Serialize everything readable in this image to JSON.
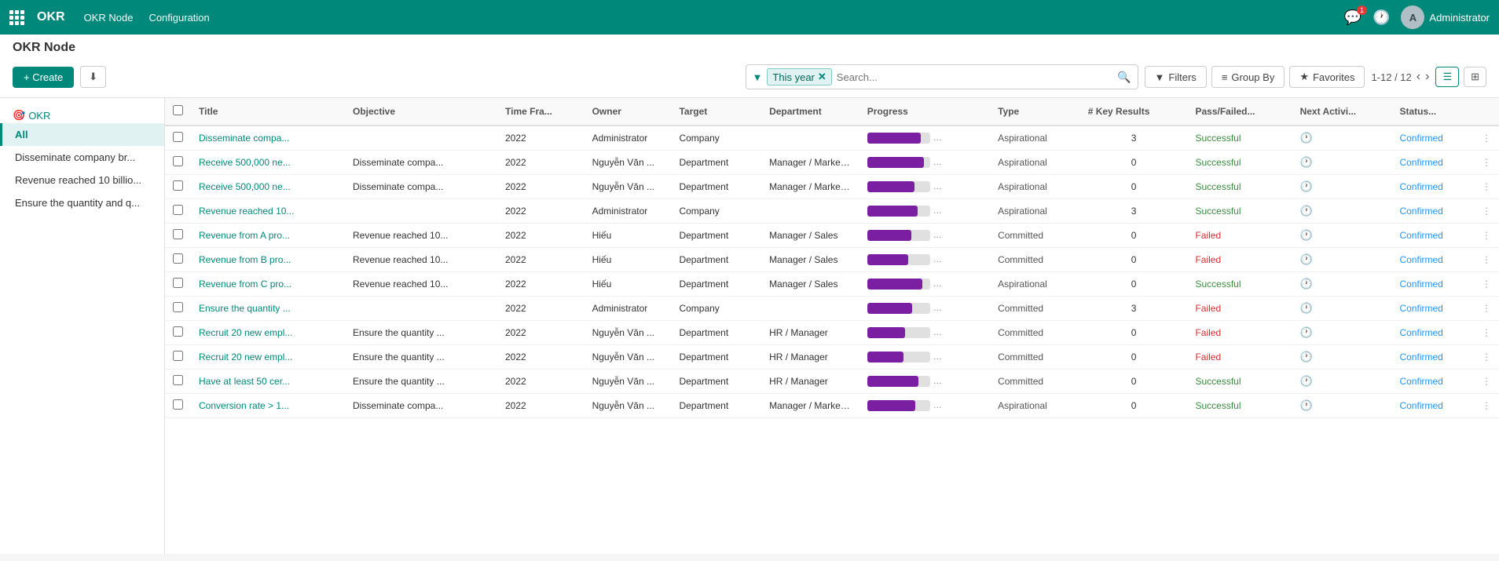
{
  "topnav": {
    "app_icon": "grid-icon",
    "app_name": "OKR",
    "menu": [
      "OKR Node",
      "Configuration"
    ],
    "chat_badge": "1",
    "user_name": "Administrator"
  },
  "page": {
    "title": "OKR Node",
    "create_label": "+ Create",
    "download_label": "⬇"
  },
  "search": {
    "filter_tag": "This year",
    "placeholder": "Search..."
  },
  "toolbar": {
    "filters_label": "Filters",
    "group_by_label": "Group By",
    "favorites_label": "Favorites",
    "pagination": "1-12 / 12"
  },
  "sidebar": {
    "section_label": "OKR",
    "items": [
      {
        "label": "All",
        "active": true
      },
      {
        "label": "Disseminate company br...",
        "active": false
      },
      {
        "label": "Revenue reached 10 billio...",
        "active": false
      },
      {
        "label": "Ensure the quantity and q...",
        "active": false
      }
    ]
  },
  "table": {
    "headers": [
      "Title",
      "Objective",
      "Time Fra...",
      "Owner",
      "Target",
      "Department",
      "Progress",
      "Type",
      "# Key Results",
      "Pass/Failed...",
      "Next Activi...",
      "Status..."
    ],
    "rows": [
      {
        "title": "Disseminate compa...",
        "objective": "",
        "time_frame": "2022",
        "owner": "Administrator",
        "target": "Company",
        "department": "",
        "progress": 85,
        "type": "Aspirational",
        "key_results": "3",
        "pass_failed": "Successful",
        "status": "Confirmed"
      },
      {
        "title": "Receive 500,000 ne...",
        "objective": "Disseminate compa...",
        "time_frame": "2022",
        "owner": "Nguyễn Văn ...",
        "target": "Department",
        "department": "Manager / Marketing",
        "progress": 90,
        "type": "Aspirational",
        "key_results": "0",
        "pass_failed": "Successful",
        "status": "Confirmed"
      },
      {
        "title": "Receive 500,000 ne...",
        "objective": "Disseminate compa...",
        "time_frame": "2022",
        "owner": "Nguyễn Văn ...",
        "target": "Department",
        "department": "Manager / Marketing",
        "progress": 75,
        "type": "Aspirational",
        "key_results": "0",
        "pass_failed": "Successful",
        "status": "Confirmed"
      },
      {
        "title": "Revenue reached 10...",
        "objective": "",
        "time_frame": "2022",
        "owner": "Administrator",
        "target": "Company",
        "department": "",
        "progress": 80,
        "type": "Aspirational",
        "key_results": "3",
        "pass_failed": "Successful",
        "status": "Confirmed"
      },
      {
        "title": "Revenue from A pro...",
        "objective": "Revenue reached 10...",
        "time_frame": "2022",
        "owner": "Hiếu",
        "target": "Department",
        "department": "Manager / Sales",
        "progress": 70,
        "type": "Committed",
        "key_results": "0",
        "pass_failed": "Failed",
        "status": "Confirmed"
      },
      {
        "title": "Revenue from B pro...",
        "objective": "Revenue reached 10...",
        "time_frame": "2022",
        "owner": "Hiếu",
        "target": "Department",
        "department": "Manager / Sales",
        "progress": 65,
        "type": "Committed",
        "key_results": "0",
        "pass_failed": "Failed",
        "status": "Confirmed"
      },
      {
        "title": "Revenue from C pro...",
        "objective": "Revenue reached 10...",
        "time_frame": "2022",
        "owner": "Hiếu",
        "target": "Department",
        "department": "Manager / Sales",
        "progress": 88,
        "type": "Aspirational",
        "key_results": "0",
        "pass_failed": "Successful",
        "status": "Confirmed"
      },
      {
        "title": "Ensure the quantity ...",
        "objective": "",
        "time_frame": "2022",
        "owner": "Administrator",
        "target": "Company",
        "department": "",
        "progress": 72,
        "type": "Committed",
        "key_results": "3",
        "pass_failed": "Failed",
        "status": "Confirmed"
      },
      {
        "title": "Recruit 20 new empl...",
        "objective": "Ensure the quantity ...",
        "time_frame": "2022",
        "owner": "Nguyễn Văn ...",
        "target": "Department",
        "department": "HR / Manager",
        "progress": 60,
        "type": "Committed",
        "key_results": "0",
        "pass_failed": "Failed",
        "status": "Confirmed"
      },
      {
        "title": "Recruit 20 new empl...",
        "objective": "Ensure the quantity ...",
        "time_frame": "2022",
        "owner": "Nguyễn Văn ...",
        "target": "Department",
        "department": "HR / Manager",
        "progress": 58,
        "type": "Committed",
        "key_results": "0",
        "pass_failed": "Failed",
        "status": "Confirmed"
      },
      {
        "title": "Have at least 50 cer...",
        "objective": "Ensure the quantity ...",
        "time_frame": "2022",
        "owner": "Nguyễn Văn ...",
        "target": "Department",
        "department": "HR / Manager",
        "progress": 82,
        "type": "Committed",
        "key_results": "0",
        "pass_failed": "Successful",
        "status": "Confirmed"
      },
      {
        "title": "Conversion rate > 1...",
        "objective": "Disseminate compa...",
        "time_frame": "2022",
        "owner": "Nguyễn Văn ...",
        "target": "Department",
        "department": "Manager / Marketing",
        "progress": 76,
        "type": "Aspirational",
        "key_results": "0",
        "pass_failed": "Successful",
        "status": "Confirmed"
      }
    ]
  }
}
